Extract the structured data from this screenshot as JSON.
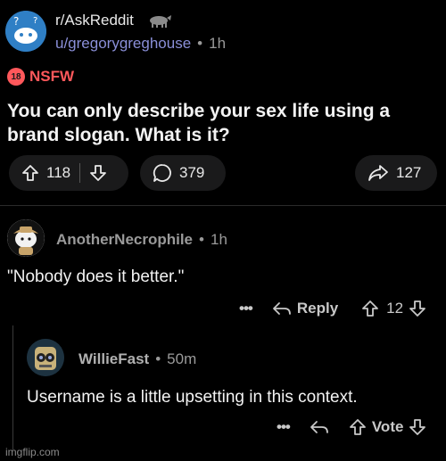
{
  "post": {
    "subreddit": "r/AskReddit",
    "author": "u/gregorygreghouse",
    "separator": "•",
    "time": "1h",
    "nsfw_badge": "18",
    "nsfw_label": "NSFW",
    "title": "You can only describe your sex life using a brand slogan. What is it?",
    "upvotes": "118",
    "comments": "379",
    "shares": "127"
  },
  "comments": [
    {
      "author": "AnotherNecrophile",
      "time": "1h",
      "text": "\"Nobody does it better.\"",
      "more": "•••",
      "reply_label": "Reply",
      "score": "12"
    },
    {
      "author": "WillieFast",
      "time": "50m",
      "text": "Username is a little upsetting in this context.",
      "more": "•••",
      "vote_label": "Vote"
    }
  ],
  "watermark": "imgflip.com",
  "icons": {
    "upvote": "arrow-up-icon",
    "downvote": "arrow-down-icon",
    "comment": "speech-bubble-icon",
    "share": "share-icon",
    "reply": "reply-icon",
    "more": "more-icon"
  },
  "colors": {
    "background": "#000000",
    "nsfw": "#ff585b",
    "username_link": "#8a8fd8"
  }
}
